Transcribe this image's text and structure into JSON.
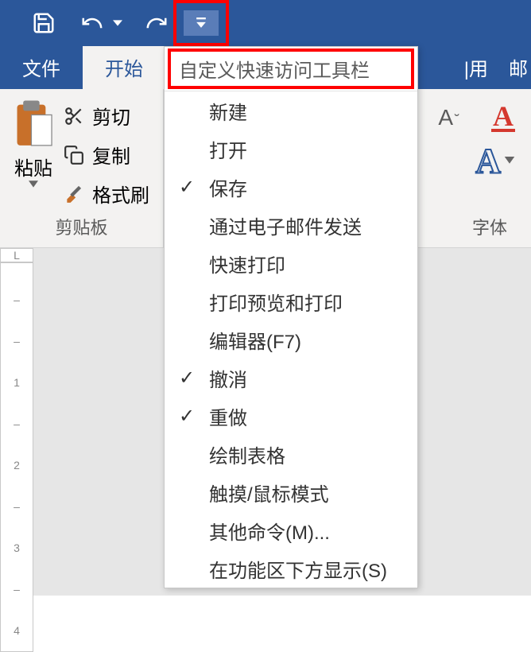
{
  "qat": {
    "icons": [
      "save",
      "undo",
      "redo"
    ]
  },
  "tabs": {
    "file": "文件",
    "home": "开始",
    "insert_partial": "|用",
    "mail_partial": "邮"
  },
  "ribbon": {
    "clipboard": {
      "paste": "粘贴",
      "cut": "剪切",
      "copy": "复制",
      "format_painter": "格式刷",
      "group_label": "剪贴板"
    },
    "font": {
      "size_down": "A",
      "group_label": "字体"
    }
  },
  "ruler": {
    "corner": "L",
    "ticks": [
      "–",
      "–",
      "1",
      "–",
      "2",
      "–",
      "3",
      "–",
      "4"
    ]
  },
  "dropdown": {
    "header": "自定义快速访问工具栏",
    "items": [
      {
        "label": "新建",
        "checked": false
      },
      {
        "label": "打开",
        "checked": false
      },
      {
        "label": "保存",
        "checked": true
      },
      {
        "label": "通过电子邮件发送",
        "checked": false
      },
      {
        "label": "快速打印",
        "checked": false
      },
      {
        "label": "打印预览和打印",
        "checked": false
      },
      {
        "label": "编辑器(F7)",
        "checked": false
      },
      {
        "label": "撤消",
        "checked": true
      },
      {
        "label": "重做",
        "checked": true
      },
      {
        "label": "绘制表格",
        "checked": false
      },
      {
        "label": "触摸/鼠标模式",
        "checked": false
      },
      {
        "label": "其他命令(M)...",
        "checked": false
      },
      {
        "label": "在功能区下方显示(S)",
        "checked": false
      }
    ]
  }
}
